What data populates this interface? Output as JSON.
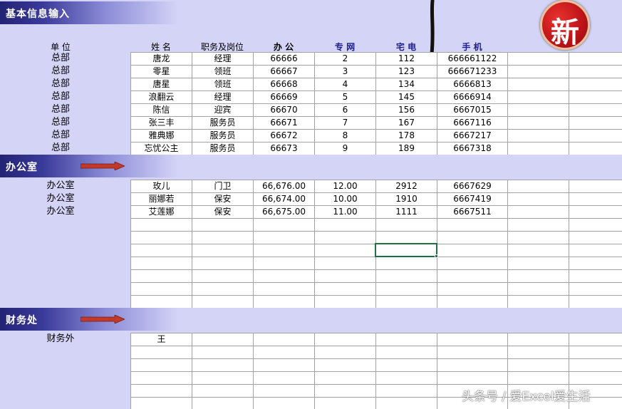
{
  "sheet_title": "基本信息输入",
  "logo_char": "新",
  "columns": {
    "unit": "单  位",
    "name": "姓  名",
    "position": "职务及岗位",
    "office": "办  公",
    "net": "专  网",
    "home": "宅  电",
    "mobile": "手  机"
  },
  "hq": {
    "rows": [
      {
        "unit": "总部",
        "name": "唐龙",
        "position": "经理",
        "office": "66666",
        "net": "2",
        "home": "112",
        "mobile": "666661122"
      },
      {
        "unit": "总部",
        "name": "零星",
        "position": "领班",
        "office": "66667",
        "net": "3",
        "home": "123",
        "mobile": "666671233"
      },
      {
        "unit": "总部",
        "name": "唐星",
        "position": "领班",
        "office": "66668",
        "net": "4",
        "home": "134",
        "mobile": "6666813"
      },
      {
        "unit": "总部",
        "name": "浪翻云",
        "position": "经理",
        "office": "66669",
        "net": "5",
        "home": "145",
        "mobile": "6666914"
      },
      {
        "unit": "总部",
        "name": "陈信",
        "position": "迎宾",
        "office": "66670",
        "net": "6",
        "home": "156",
        "mobile": "6667015"
      },
      {
        "unit": "总部",
        "name": "张三丰",
        "position": "服务员",
        "office": "66671",
        "net": "7",
        "home": "167",
        "mobile": "6667116"
      },
      {
        "unit": "总部",
        "name": "雅典娜",
        "position": "服务员",
        "office": "66672",
        "net": "8",
        "home": "178",
        "mobile": "6667217"
      },
      {
        "unit": "总部",
        "name": "忘忧公主",
        "position": "服务员",
        "office": "66673",
        "net": "9",
        "home": "189",
        "mobile": "6667318"
      }
    ]
  },
  "office_section": {
    "label": "办公室",
    "rows": [
      {
        "unit": "办公室",
        "name": "玫儿",
        "position": "门卫",
        "office": "66,676.00",
        "net": "12.00",
        "home": "2912",
        "mobile": "6667629"
      },
      {
        "unit": "办公室",
        "name": "丽娜若",
        "position": "保安",
        "office": "66,674.00",
        "net": "10.00",
        "home": "1910",
        "mobile": "6667419"
      },
      {
        "unit": "办公室",
        "name": "艾莲娜",
        "position": "保安",
        "office": "66,675.00",
        "net": "11.00",
        "home": "1111",
        "mobile": "6667511"
      }
    ]
  },
  "finance_section": {
    "label": "财务处",
    "rows": [
      {
        "unit": "财务外",
        "name": "王",
        "position": "",
        "office": "",
        "net": "",
        "home": "",
        "mobile": ""
      }
    ]
  },
  "watermark": "头条号 / 爱Excel爱生活"
}
